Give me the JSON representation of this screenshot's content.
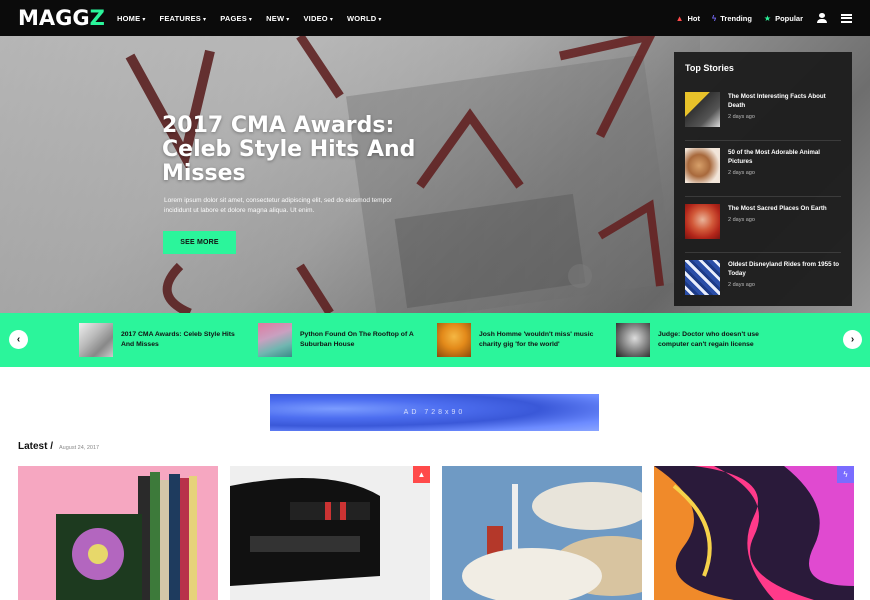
{
  "brand": {
    "logo_main": "MAGG",
    "logo_accent": "Z"
  },
  "nav": {
    "items": [
      {
        "label": "HOME"
      },
      {
        "label": "FEATURES"
      },
      {
        "label": "PAGES"
      },
      {
        "label": "NEW"
      },
      {
        "label": "VIDEO"
      },
      {
        "label": "WORLD"
      }
    ],
    "right": {
      "hot": "Hot",
      "trending": "Trending",
      "popular": "Popular"
    }
  },
  "hero": {
    "title": "2017 CMA Awards: Celeb Style Hits And Misses",
    "description": "Lorem ipsum dolor sit amet, consectetur adipiscing elit, sed do eiusmod tempor incididunt ut labore et dolore magna aliqua. Ut enim.",
    "cta": "SEE MORE"
  },
  "top_stories": {
    "title": "Top Stories",
    "items": [
      {
        "headline": "The Most Interesting Facts About Death",
        "time": "2 days ago"
      },
      {
        "headline": "50 of the Most Adorable Animal Pictures",
        "time": "2 days ago"
      },
      {
        "headline": "The Most Sacred Places On Earth",
        "time": "2 days ago"
      },
      {
        "headline": "Oldest Disneyland Rides from 1955 to Today",
        "time": "2 days ago"
      }
    ]
  },
  "ticker": {
    "items": [
      {
        "headline": "2017 CMA Awards: Celeb Style Hits And Misses"
      },
      {
        "headline": "Python Found On The Rooftop of A Suburban House"
      },
      {
        "headline": "Josh Homme 'wouldn't miss' music charity gig 'for the world'"
      },
      {
        "headline": "Judge: Doctor who doesn't use computer can't regain license"
      }
    ],
    "prev": "‹",
    "next": "›"
  },
  "ad": {
    "label": "AD 728x90"
  },
  "latest": {
    "title": "Latest /",
    "date": "August 24, 2017"
  },
  "colors": {
    "accent": "#2bf59b",
    "hot": "#ff4a4a",
    "trending": "#7a6cff"
  }
}
